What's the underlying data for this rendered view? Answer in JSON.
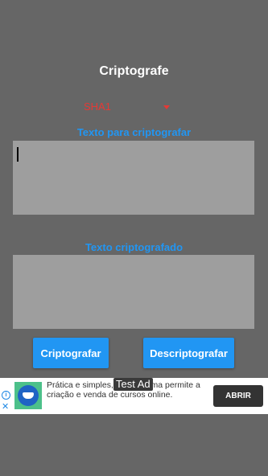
{
  "app": {
    "title": "Criptografe"
  },
  "algorithm_select": {
    "selected": "SHA1"
  },
  "input_section": {
    "label": "Texto para criptografar",
    "value": "",
    "placeholder": ""
  },
  "output_section": {
    "label": "Texto criptografado",
    "value": "",
    "placeholder": ""
  },
  "buttons": {
    "encrypt_label": "Criptografar",
    "decrypt_label": "Descriptografar"
  },
  "ad_banner": {
    "badge": "Test Ad",
    "text": "Prática e simples, a plataforma permite a criação e venda de cursos online.",
    "cta_label": "ABRIR"
  },
  "colors": {
    "background": "#666666",
    "accent": "#2196f3",
    "select_text": "#e53935",
    "textbox": "#9e9e9e"
  }
}
